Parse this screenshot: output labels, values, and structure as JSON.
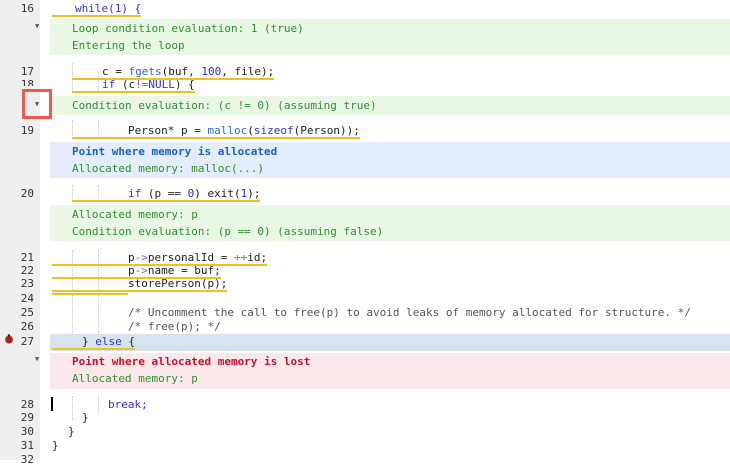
{
  "lines": {
    "l16": {
      "num": "16"
    },
    "l17": {
      "num": "17"
    },
    "l18": {
      "num": "18"
    },
    "l19": {
      "num": "19"
    },
    "l20": {
      "num": "20"
    },
    "l21": {
      "num": "21"
    },
    "l22": {
      "num": "22"
    },
    "l23": {
      "num": "23"
    },
    "l24": {
      "num": "24"
    },
    "l25": {
      "num": "25"
    },
    "l26": {
      "num": "26"
    },
    "l27": {
      "num": "27"
    },
    "l28": {
      "num": "28"
    },
    "l29": {
      "num": "29"
    },
    "l30": {
      "num": "30"
    },
    "l31": {
      "num": "31"
    },
    "l32": {
      "num": "32"
    }
  },
  "code": {
    "l16": "while(1) {",
    "l17_a": "c = ",
    "l17_fn": "fgets",
    "l17_b": "(buf, ",
    "l17_num": "100",
    "l17_c": ", file);",
    "l18_kw": "if",
    "l18_a": " (c",
    "l18_op": "!=",
    "l18_null": "NULL",
    "l18_b": ") {",
    "l19_a": "Person* p = ",
    "l19_fn": "malloc",
    "l19_b": "(",
    "l19_kw": "sizeof",
    "l19_c": "(Person));",
    "l20_kw": "if",
    "l20_a": " (p == ",
    "l20_num": "0",
    "l20_b": ") exit(",
    "l20_num2": "1",
    "l20_c": ");",
    "l21_a": "p",
    "l21_op": "->",
    "l21_b": "personalId = ",
    "l21_op2": "++",
    "l21_c": "id;",
    "l22_a": "p",
    "l22_op": "->",
    "l22_b": "name = buf;",
    "l23": "storePerson(p);",
    "l25": "/* Uncomment the call to free(p) to avoid leaks of memory allocated for structure. */",
    "l26": "/* free(p); */",
    "l27_a": "} ",
    "l27_kw": "else",
    "l27_b": " {",
    "l28": "break;",
    "l29": "}",
    "l30": "}",
    "l31": "}"
  },
  "messages": {
    "m1": "Loop condition evaluation: 1 (true)",
    "m2": "Entering the loop",
    "m3": "Condition evaluation: (c != 0) (assuming true)",
    "m4": "Point where memory is allocated",
    "m5": "Allocated memory: malloc(...)",
    "m6": "Allocated memory: p",
    "m7": "Condition evaluation: (p == 0) (assuming false)",
    "m8": "Point where allocated memory is lost",
    "m9": "Allocated memory: p"
  },
  "colors": {
    "underline": "#f0c020",
    "green_band": "#e9f8e4",
    "blue_band": "#e3edfb",
    "red_band": "#fbe8ea",
    "highlight_box": "#f05a4a"
  },
  "icons": {
    "fold": "chevron-down-icon",
    "bug": "ladybug-icon"
  }
}
